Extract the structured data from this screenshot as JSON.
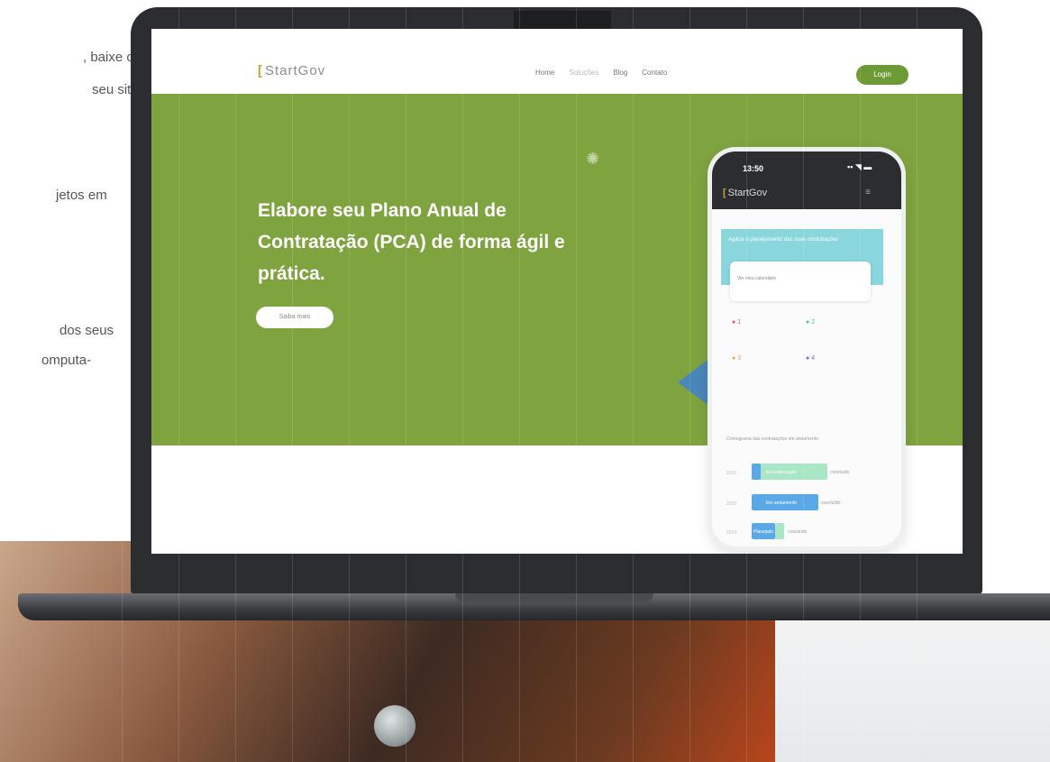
{
  "background_text": [
    ", baixe o",
    "seu site.",
    "jetos em",
    "dos seus",
    "omputa-"
  ],
  "website": {
    "logo": "StartGov",
    "nav": [
      "Home",
      "Soluções",
      "Blog",
      "Contato"
    ],
    "login_button": "Login",
    "hero_title": "Elabore seu Plano Anual de Contratação (PCA) de forma ágil e prática.",
    "hero_button": "Saiba mais",
    "accent_color": "#7ea33f"
  },
  "phone": {
    "time": "13:50",
    "status_icons": "▪▪ ◥ ▬",
    "logo": "StartGov",
    "menu_icon": "≡",
    "banner_text": "Agilize o planejamento das suas contratações",
    "card_text": "Ver meu calendário",
    "stats": [
      "1",
      "2",
      "3",
      "4"
    ],
    "chart_title": "Cronograma das contratações em andamento",
    "bars": [
      {
        "year": "2022",
        "label": "Em elaboração",
        "note": "concluído"
      },
      {
        "year": "2023",
        "label": "Em andamento",
        "note": "concluído"
      },
      {
        "year": "2024",
        "label": "Planejado",
        "note": "concluído"
      }
    ]
  }
}
